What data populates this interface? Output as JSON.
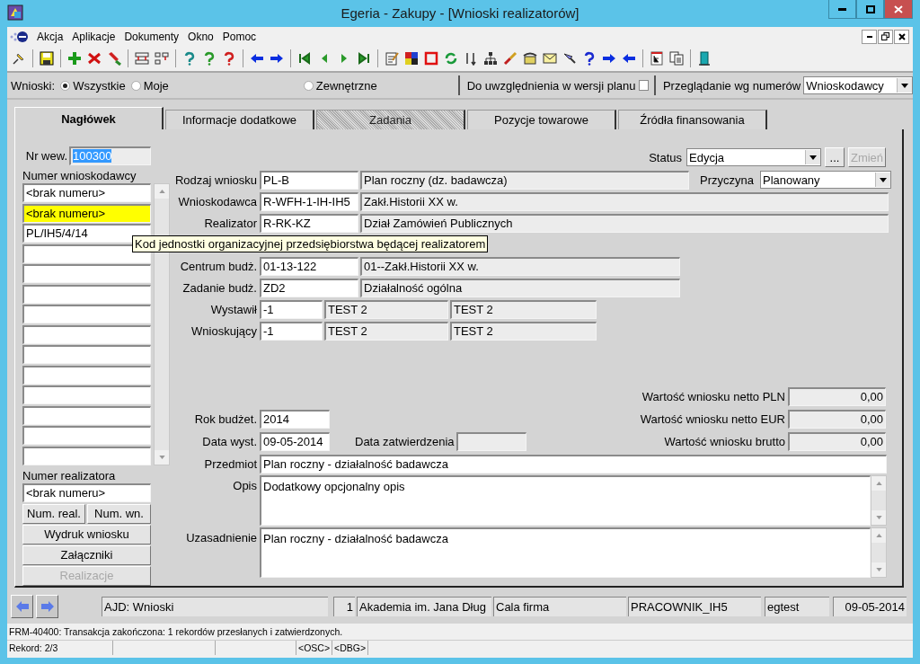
{
  "window": {
    "title": "Egeria - Zakupy - [Wnioski realizatorów]"
  },
  "menu": [
    "Akcja",
    "Aplikacje",
    "Dokumenty",
    "Okno",
    "Pomoc"
  ],
  "filter": {
    "label": "Wnioski:",
    "options": [
      {
        "label": "Wszystkie",
        "selected": true
      },
      {
        "label": "Moje",
        "selected": false
      },
      {
        "label": "Zewnętrzne",
        "selected": false
      }
    ],
    "plan": {
      "label": "Do uwzględnienia w wersji planu",
      "checked": false
    },
    "browse": {
      "label": "Przeglądanie wg numerów",
      "value": "Wnioskodawcy"
    }
  },
  "tabs": [
    {
      "label": "Nagłówek",
      "selected": true,
      "disabled": false
    },
    {
      "label": "Informacje dodatkowe",
      "selected": false,
      "disabled": false
    },
    {
      "label": "Zadania",
      "selected": false,
      "disabled": true
    },
    {
      "label": "Pozycje towarowe",
      "selected": false,
      "disabled": false
    },
    {
      "label": "Źródła finansowania",
      "selected": false,
      "disabled": false
    }
  ],
  "left": {
    "nr_wew": {
      "label": "Nr wew.",
      "value": "100300"
    },
    "applicant_numbers": {
      "label": "Numer wnioskodawcy",
      "rows": [
        {
          "value": "<brak numeru>",
          "selected": false
        },
        {
          "value": "<brak numeru>",
          "selected": true
        },
        {
          "value": "PL/IH5/4/14",
          "selected": false
        }
      ]
    },
    "realizer_number": {
      "label": "Numer realizatora",
      "value": "<brak numeru>"
    },
    "buttons": [
      {
        "label": "Num. real.",
        "disabled": false
      },
      {
        "label": "Num. wn.",
        "disabled": false
      },
      {
        "label": "Wydruk wniosku",
        "disabled": false
      },
      {
        "label": "Załączniki",
        "disabled": false
      },
      {
        "label": "Realizacje",
        "disabled": true
      }
    ]
  },
  "form": {
    "status": {
      "label": "Status",
      "value": "Edycja",
      "more": "...",
      "change": {
        "label": "Zmień",
        "disabled": true
      }
    },
    "reason": {
      "label": "Przyczyna",
      "value": "Planowany"
    },
    "type": {
      "label": "Rodzaj wniosku",
      "code": "PL-B",
      "name": "Plan roczny (dz. badawcza)"
    },
    "applicant": {
      "label": "Wnioskodawca",
      "code": "R-WFH-1-IH-IH5",
      "name": "Zakł.Historii XX w."
    },
    "realizer": {
      "label": "Realizator",
      "code": "R-RK-KZ",
      "name": "Dział Zamówień Publicznych"
    },
    "tooltip": "Kod jednostki organizacyjnej przedsiębiorstwa będącej realizatorem",
    "budget_center": {
      "label": "Centrum budż.",
      "code": "01-13-122",
      "name": "01--Zakł.Historii XX w."
    },
    "budget_task": {
      "label": "Zadanie budż.",
      "code": "ZD2",
      "name": "Działalność ogólna"
    },
    "issuer": {
      "label": "Wystawił",
      "code": "-1",
      "first": "TEST 2",
      "second": "TEST 2"
    },
    "requester": {
      "label": "Wnioskujący",
      "code": "-1",
      "first": "TEST 2",
      "second": "TEST 2"
    },
    "net_pln": {
      "label": "Wartość wniosku netto PLN",
      "value": "0,00"
    },
    "net_eur": {
      "label": "Wartość wniosku netto EUR",
      "value": "0,00"
    },
    "gross": {
      "label": "Wartość wniosku brutto",
      "value": "0,00"
    },
    "budget_year": {
      "label": "Rok budżet.",
      "value": "2014"
    },
    "issue_date": {
      "label": "Data wyst.",
      "value": "09-05-2014"
    },
    "approval_date": {
      "label": "Data zatwierdzenia"
    },
    "subject": {
      "label": "Przedmiot",
      "value": "Plan roczny - działalność badawcza"
    },
    "description": {
      "label": "Opis",
      "value": "Dodatkowy opcjonalny opis"
    },
    "justification": {
      "label": "Uzasadnienie",
      "value": "Plan roczny - działalność badawcza"
    }
  },
  "status_bar": [
    "AJD: Wnioski",
    "1",
    "Akademia im. Jana Dług",
    "Cala firma",
    "PRACOWNIK_IH5",
    "egtest",
    "09-05-2014"
  ],
  "message_bar": {
    "message": "FRM-40400: Transakcja zakończona: 1 rekordów przesłanych i zatwierdzonych.",
    "record": "Rekord: 2/3",
    "flags": [
      "<OSC>",
      "<DBG>"
    ]
  }
}
